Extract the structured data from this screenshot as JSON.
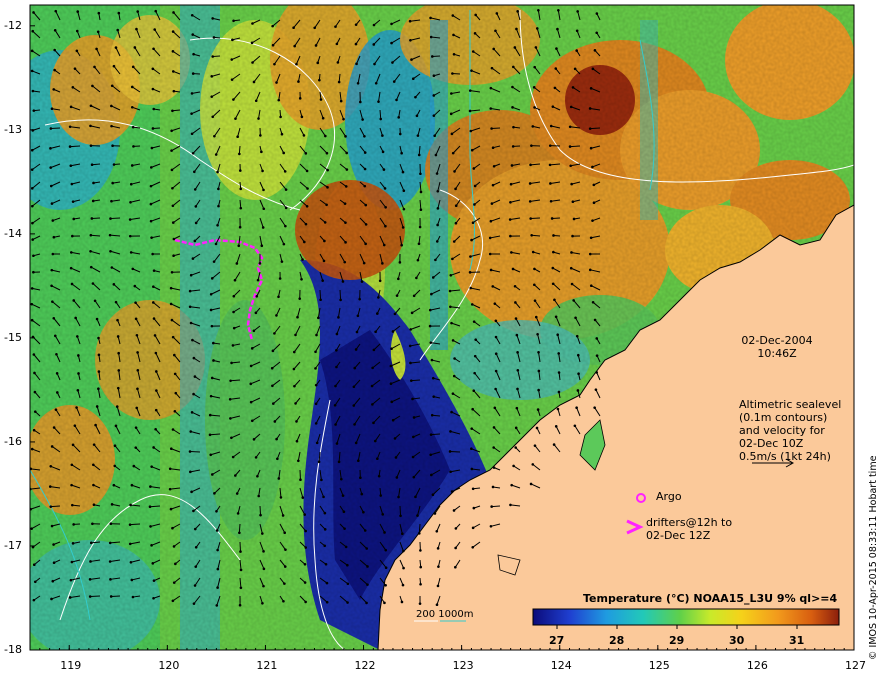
{
  "map": {
    "lon_range": [
      118.6,
      127
    ],
    "lat_range": [
      -18,
      -11.8
    ],
    "x_ticks": [
      "119",
      "120",
      "121",
      "122",
      "123",
      "124",
      "125",
      "126",
      "127"
    ],
    "y_ticks": [
      "-12",
      "-13",
      "-14",
      "-15",
      "-16",
      "-17",
      "-18"
    ],
    "land_color": "#fbc99a",
    "contour_color": "#ffffff"
  },
  "annotations": {
    "date": "02-Dec-2004",
    "time": "10:46Z",
    "altimetry_lines": [
      "Altimetric sealevel",
      "(0.1m contours)",
      "and velocity for",
      "02-Dec 10Z",
      "0.5m/s (1kt 24h)"
    ],
    "argo_label": "Argo",
    "drifters_lines": [
      "drifters@12h to",
      "02-Dec 12Z"
    ],
    "bathymetry_label": "200  1000m"
  },
  "colorbar": {
    "title": "Temperature (°C) NOAA15_L3U 9% ql>=4",
    "ticks": [
      "27",
      "28",
      "29",
      "30",
      "31"
    ],
    "range": [
      26.6,
      31.7
    ]
  },
  "credit": "© IMOS 10-Apr-2015 08:33:11 Hobart time",
  "colors": {
    "magenta": "#ff22ff",
    "cyan": "#33cccc"
  }
}
